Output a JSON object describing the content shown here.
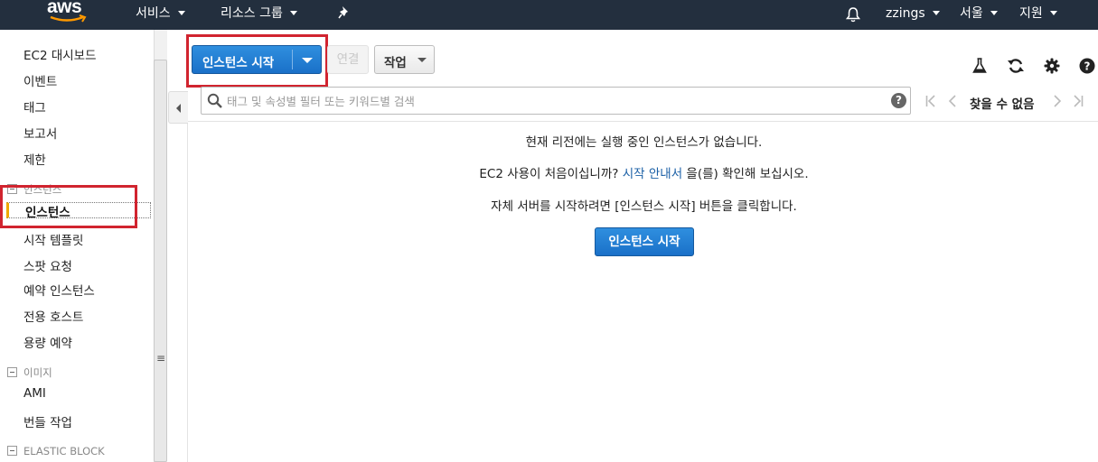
{
  "topnav": {
    "logo": "aws",
    "services": "서비스",
    "resource_groups": "리소스 그룹",
    "user": "zzings",
    "region": "서울",
    "support": "지원"
  },
  "sidebar": {
    "items": [
      "EC2 대시보드",
      "이벤트",
      "태그",
      "보고서",
      "제한"
    ],
    "instances_section": "인스턴스",
    "active_item": "인스턴스",
    "instance_items": [
      "시작 템플릿",
      "스팟 요청",
      "예약 인스턴스",
      "전용 호스트",
      "용량 예약"
    ],
    "images_section": "이미지",
    "image_items": [
      "AMI",
      "번들 작업"
    ],
    "ebs_section": "ELASTIC BLOCK"
  },
  "toolbar": {
    "launch_label": "인스턴스 시작",
    "connect_label": "연결",
    "actions_label": "작업"
  },
  "search": {
    "placeholder": "태그 및 속성별 필터 또는 키워드별 검색",
    "help": "?",
    "pager_text": "찾을 수 없음"
  },
  "empty": {
    "line1": "현재 리전에는 실행 중인 인스턴스가 없습니다.",
    "line2_pre": "EC2 사용이 처음이십니까? ",
    "line2_link": "시작 안내서",
    "line2_post": " 을(를) 확인해 보십시오.",
    "line3": "자체 서버를 시작하려면 [인스턴스 시작] 버튼을 클릭합니다.",
    "button": "인스턴스 시작"
  },
  "colors": {
    "nav_bg": "#232f3e",
    "primary": "#1a70c8",
    "highlight": "#d1242f",
    "active_marker": "#f0a800"
  }
}
